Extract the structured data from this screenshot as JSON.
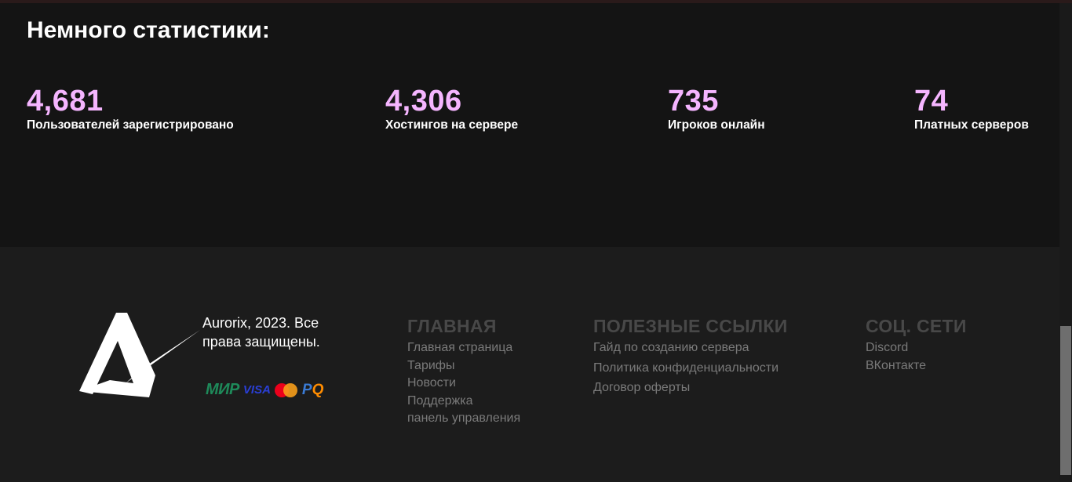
{
  "stats": {
    "title": "Немного статистики:",
    "items": [
      {
        "value": "4,681",
        "label": "Пользователей зарегистрировано"
      },
      {
        "value": "4,306",
        "label": "Хостингов на сервере"
      },
      {
        "value": "735",
        "label": "Игроков онлайн"
      },
      {
        "value": "74",
        "label": "Платных серверов"
      }
    ],
    "value_color": "#f5b5ff"
  },
  "footer": {
    "copyright": "Aurorix, 2023. Все права защищены.",
    "payments": {
      "mir": "МИР",
      "visa": "VISA",
      "pq_main": "P",
      "pq_accent": "Q"
    },
    "columns": {
      "main": {
        "title": "ГЛАВНАЯ",
        "links": [
          "Главная страница",
          "Тарифы",
          "Новости",
          "Поддержка",
          "панель управления"
        ]
      },
      "useful": {
        "title": "ПОЛЕЗНЫЕ ССЫЛКИ",
        "links": [
          "Гайд по созданию сервера",
          "Политика конфиденциальности",
          "Договор оферты"
        ]
      },
      "social": {
        "title": "СОЦ. СЕТИ",
        "links": [
          "Discord",
          "ВКонтакте"
        ]
      }
    }
  },
  "icons": {
    "logo": "aurorix-logo-icon",
    "mastercard": "mastercard-icon"
  }
}
